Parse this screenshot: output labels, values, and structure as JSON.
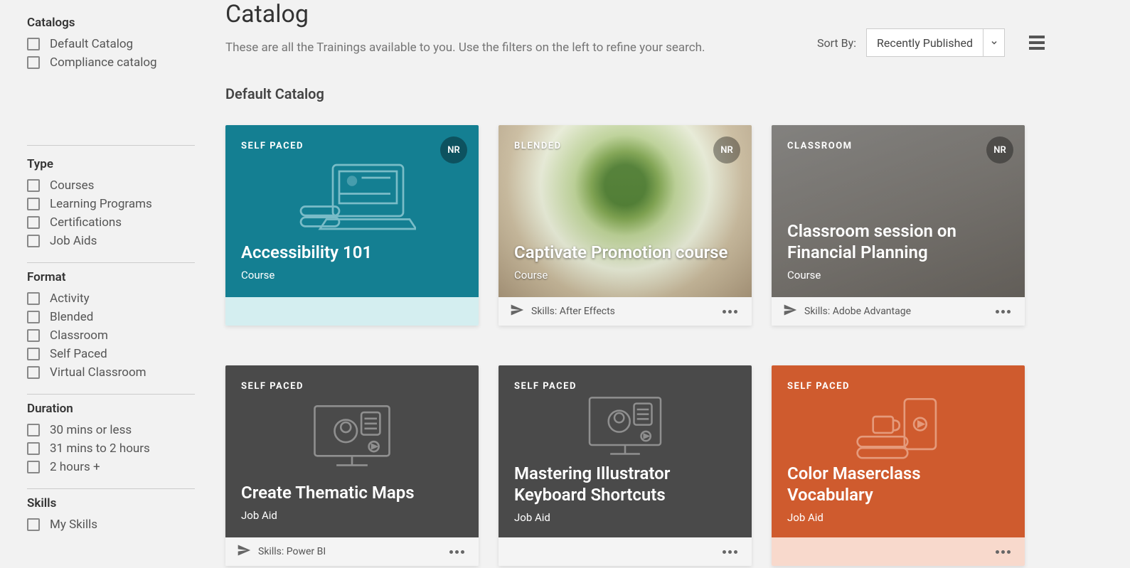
{
  "sidebar": {
    "catalogs": {
      "heading": "Catalogs",
      "items": [
        "Default Catalog",
        "Compliance catalog"
      ]
    },
    "type": {
      "heading": "Type",
      "items": [
        "Courses",
        "Learning Programs",
        "Certifications",
        "Job Aids"
      ]
    },
    "format": {
      "heading": "Format",
      "items": [
        "Activity",
        "Blended",
        "Classroom",
        "Self Paced",
        "Virtual Classroom"
      ]
    },
    "duration": {
      "heading": "Duration",
      "items": [
        "30 mins or less",
        "31 mins to 2 hours",
        "2 hours +"
      ]
    },
    "skills": {
      "heading": "Skills",
      "items": [
        "My Skills"
      ]
    }
  },
  "main": {
    "title": "Catalog",
    "subtitle": "These are all the Trainings available to you. Use the filters on the left to refine your search.",
    "sort_label": "Sort By:",
    "sort_value": "Recently Published",
    "section": "Default Catalog"
  },
  "cards": [
    {
      "format": "SELF PACED",
      "badge": "NR",
      "title": "Accessibility 101",
      "type": "Course",
      "skills": ""
    },
    {
      "format": "BLENDED",
      "badge": "NR",
      "title": "Captivate Promotion course",
      "type": "Course",
      "skills": "Skills: After Effects"
    },
    {
      "format": "CLASSROOM",
      "badge": "NR",
      "title": "Classroom session on Financial Planning",
      "type": "Course",
      "skills": "Skills: Adobe Advantage"
    },
    {
      "format": "SELF PACED",
      "badge": "",
      "title": "Create Thematic Maps",
      "type": "Job Aid",
      "skills": "Skills: Power BI"
    },
    {
      "format": "SELF PACED",
      "badge": "",
      "title": "Mastering Illustrator Keyboard Shortcuts",
      "type": "Job Aid",
      "skills": ""
    },
    {
      "format": "SELF PACED",
      "badge": "",
      "title": "Color Maserclass Vocabulary",
      "type": "Job Aid",
      "skills": ""
    }
  ]
}
